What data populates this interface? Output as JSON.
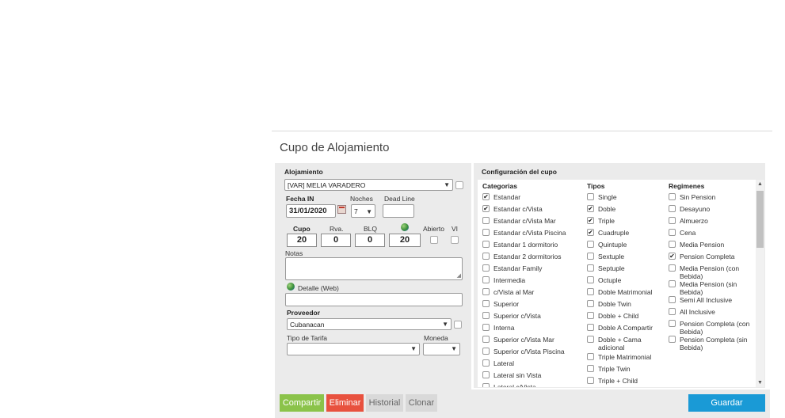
{
  "dialog": {
    "title": "Cupo de Alojamiento"
  },
  "form": {
    "alojamiento_label": "Alojamiento",
    "alojamiento_value": "[VAR] MELIA VARADERO",
    "fecha_in_label": "Fecha IN",
    "fecha_in_value": "31/01/2020",
    "noches_label": "Noches",
    "noches_value": "7",
    "dead_line_label": "Dead Line",
    "dead_line_value": "",
    "cupo_label": "Cupo",
    "cupo_value": "20",
    "rva_label": "Rva.",
    "rva_value": "0",
    "blq_label": "BLQ",
    "blq_value": "0",
    "globe_value": "20",
    "abierto_label": "Abierto",
    "vi_label": "VI",
    "notas_label": "Notas",
    "detalle_label": "Detalle (Web)",
    "proveedor_label": "Proveedor",
    "proveedor_value": "Cubanacan",
    "tipo_tarifa_label": "Tipo de Tarifa",
    "moneda_label": "Moneda"
  },
  "config": {
    "title": "Configuración del cupo",
    "categorias_label": "Categorias",
    "tipos_label": "Tipos",
    "regimenes_label": "Regimenes",
    "categorias": [
      {
        "label": "Estandar",
        "checked": true
      },
      {
        "label": "Estandar c/Vista",
        "checked": true
      },
      {
        "label": "Estandar c/Vista Mar",
        "checked": false
      },
      {
        "label": "Estandar c/Vista Piscina",
        "checked": false
      },
      {
        "label": "Estandar 1 dormitorio",
        "checked": false
      },
      {
        "label": "Estandar 2 dormitorios",
        "checked": false
      },
      {
        "label": "Estandar Family",
        "checked": false
      },
      {
        "label": "Intermedia",
        "checked": false
      },
      {
        "label": "c/Vista al Mar",
        "checked": false
      },
      {
        "label": "Superior",
        "checked": false
      },
      {
        "label": "Superior c/Vista",
        "checked": false
      },
      {
        "label": "Interna",
        "checked": false
      },
      {
        "label": "Superior c/Vista Mar",
        "checked": false
      },
      {
        "label": "Superior c/Vista Piscina",
        "checked": false
      },
      {
        "label": "Lateral",
        "checked": false
      },
      {
        "label": "Lateral sin Vista",
        "checked": false
      },
      {
        "label": "Lateral c/Vista",
        "checked": false
      }
    ],
    "tipos": [
      {
        "label": "Single",
        "checked": false
      },
      {
        "label": "Doble",
        "checked": true
      },
      {
        "label": "Triple",
        "checked": true
      },
      {
        "label": "Cuadruple",
        "checked": true
      },
      {
        "label": "Quintuple",
        "checked": false
      },
      {
        "label": "Sextuple",
        "checked": false
      },
      {
        "label": "Septuple",
        "checked": false
      },
      {
        "label": "Octuple",
        "checked": false
      },
      {
        "label": "Doble Matrimonial",
        "checked": false
      },
      {
        "label": "Doble Twin",
        "checked": false
      },
      {
        "label": "Doble + Child",
        "checked": false
      },
      {
        "label": "Doble A Compartir",
        "checked": false
      },
      {
        "label": "Doble + Cama adicional",
        "checked": false
      },
      {
        "label": "Triple Matrimonial",
        "checked": false
      },
      {
        "label": "Triple Twin",
        "checked": false
      },
      {
        "label": "Triple + Child",
        "checked": false
      }
    ],
    "regimenes": [
      {
        "label": "Sin Pension",
        "checked": false
      },
      {
        "label": "Desayuno",
        "checked": false
      },
      {
        "label": "Almuerzo",
        "checked": false
      },
      {
        "label": "Cena",
        "checked": false
      },
      {
        "label": "Media Pension",
        "checked": false
      },
      {
        "label": "Pension Completa",
        "checked": true
      },
      {
        "label": "Media Pension (con Bebida)",
        "checked": false
      },
      {
        "label": "Media Pension (sin Bebida)",
        "checked": false
      },
      {
        "label": "Semi All Inclusive",
        "checked": false
      },
      {
        "label": "All Inclusive",
        "checked": false
      },
      {
        "label": "Pension Completa (con Bebida)",
        "checked": false
      },
      {
        "label": "Pension Completa (sin Bebida)",
        "checked": false
      }
    ]
  },
  "footer": {
    "compartir_label": "Compartir",
    "eliminar_label": "Eliminar",
    "historial_label": "Historial",
    "clonar_label": "Clonar",
    "guardar_label": "Guardar"
  },
  "colors": {
    "compartir": "#8bc34a",
    "eliminar": "#e8513e",
    "historial": "#d9d9d9",
    "clonar": "#d9d9d9",
    "guardar": "#1a9ad6"
  }
}
